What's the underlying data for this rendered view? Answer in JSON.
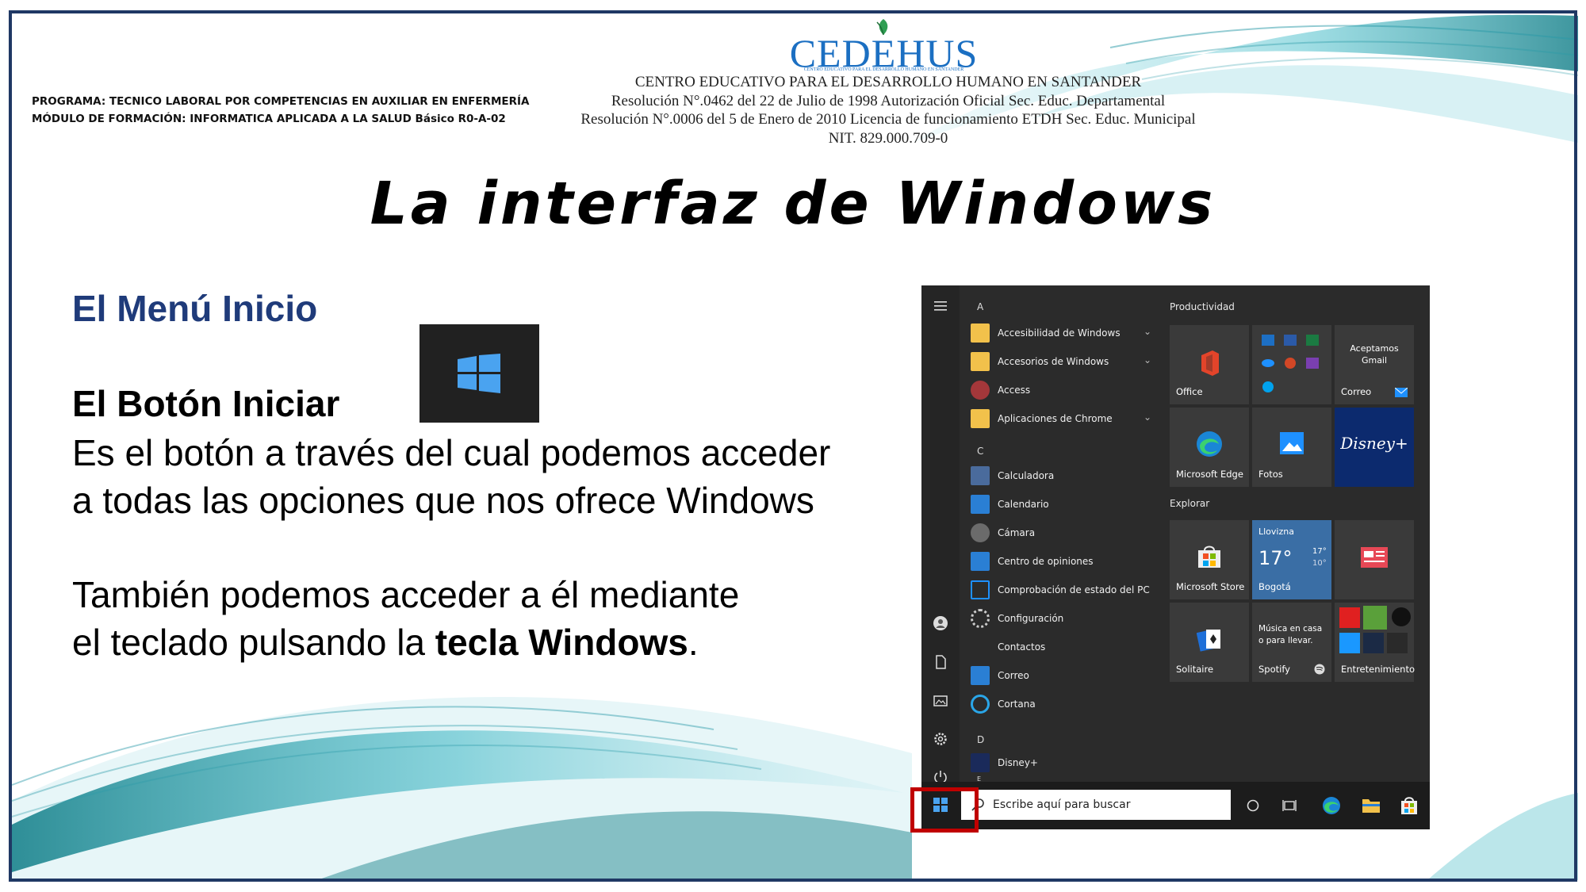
{
  "header": {
    "program_line1": "PROGRAMA: TECNICO LABORAL POR COMPETENCIAS EN AUXILIAR EN ENFERMERÍA",
    "program_line2": "MÓDULO DE FORMACIÓN: INFORMATICA APLICADA A LA SALUD Básico R0-A-02",
    "logo_text": "CEDEHUS",
    "logo_subtext": "CENTRO EDUCATIVO PARA EL DESARROLLO HUMANO EN SANTANDER",
    "institution_line1": "CENTRO EDUCATIVO PARA EL DESARROLLO HUMANO EN SANTANDER",
    "institution_line2": "Resolución  N°.0462 del 22 de Julio de 1998  Autorización Oficial Sec. Educ. Departamental",
    "institution_line3": "Resolución N°.0006 del 5 de Enero de 2010 Licencia de funcionamiento ETDH Sec. Educ. Municipal",
    "institution_line4": "NIT. 829.000.709-0"
  },
  "slide": {
    "title": "La interfaz de Windows",
    "subtitle": "El Menú Inicio",
    "button_title": "El Botón Iniciar",
    "para1_line1": "Es el botón a través del cual podemos acceder",
    "para1_line2": "a todas las opciones que nos ofrece Windows",
    "para2_line1": "También podemos acceder a él mediante",
    "para2_line2_pre": "el teclado pulsando la ",
    "para2_line2_bold": "tecla Windows",
    "para2_line2_post": "."
  },
  "start_menu": {
    "letters": [
      "A",
      "C",
      "D",
      "E"
    ],
    "apps": [
      {
        "label": "Accesibilidad de Windows",
        "icon": "folder-icon",
        "color": "#f2c14b",
        "chevron": "⌄"
      },
      {
        "label": "Accesorios de Windows",
        "icon": "folder-icon",
        "color": "#f2c14b",
        "chevron": "⌄"
      },
      {
        "label": "Access",
        "icon": "access-icon",
        "color": "#a4373a",
        "chevron": ""
      },
      {
        "label": "Aplicaciones de Chrome",
        "icon": "folder-icon",
        "color": "#f2c14b",
        "chevron": "⌄"
      },
      {
        "label": "Calculadora",
        "icon": "calculator-icon",
        "color": "#4a6b9c",
        "chevron": ""
      },
      {
        "label": "Calendario",
        "icon": "calendar-icon",
        "color": "#2a7fd4",
        "chevron": ""
      },
      {
        "label": "Cámara",
        "icon": "camera-icon",
        "color": "#6b6b6b",
        "chevron": ""
      },
      {
        "label": "Centro de opiniones",
        "icon": "feedback-icon",
        "color": "#2a7fd4",
        "chevron": ""
      },
      {
        "label": "Comprobación de estado del PC",
        "icon": "health-check-icon",
        "color": "#1e90ff",
        "chevron": ""
      },
      {
        "label": "Configuración",
        "icon": "settings-gear-icon",
        "color": "#cccccc",
        "chevron": ""
      },
      {
        "label": "Contactos",
        "icon": "contacts-icon",
        "color": "#2b2b2b",
        "chevron": ""
      },
      {
        "label": "Correo",
        "icon": "mail-icon",
        "color": "#2a7fd4",
        "chevron": ""
      },
      {
        "label": "Cortana",
        "icon": "cortana-icon",
        "color": "#2aa6e8",
        "chevron": ""
      },
      {
        "label": "Disney+",
        "icon": "disney-icon",
        "color": "#1a2a5a",
        "chevron": ""
      }
    ],
    "groups": [
      "Productividad",
      "Explorar"
    ],
    "tiles": {
      "office": "Office",
      "gmail_line1": "Aceptamos",
      "gmail_line2": "Gmail",
      "correo": "Correo",
      "edge": "Microsoft Edge",
      "fotos": "Fotos",
      "store": "Microsoft Store",
      "weather_city": "Llovizna",
      "weather_temp": "17°",
      "weather_hi": "17°",
      "weather_lo": "10°",
      "weather_place": "Bogotá",
      "solitaire": "Solitaire",
      "spotify_line1": "Música en casa",
      "spotify_line2": "o para llevar.",
      "spotify": "Spotify",
      "entertainment": "Entretenimiento",
      "disney_logo": "Disney+"
    },
    "search_placeholder": "Escribe aquí para buscar"
  },
  "colors": {
    "frame": "#1f3864",
    "subtitle": "#1f3b7a",
    "highlight": "#c00000",
    "start_bg": "#2b2b2b"
  }
}
